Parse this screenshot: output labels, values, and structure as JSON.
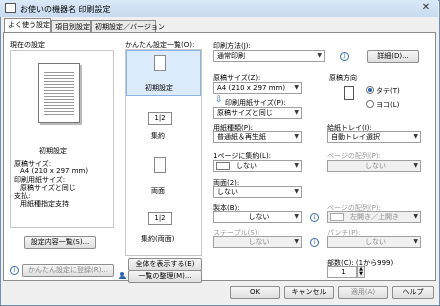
{
  "window": {
    "title": "お使いの機器名 印刷設定",
    "close": "✕"
  },
  "tabs": [
    "よく使う設定",
    "項目別設定",
    "初期設定／バージョン"
  ],
  "left": {
    "current_settings": "現在の設定",
    "preview_caption": "初期設定",
    "summary": [
      "原稿サイズ:",
      "A4 (210 x 297 mm)",
      "印刷用紙サイズ:",
      "原稿サイズと同じ",
      "支払:",
      "用紙種指定支持"
    ],
    "settings_list_button": "設定内容一覧(S)...",
    "register_button": "かんたん設定に登録(R)..."
  },
  "presets": {
    "header": "かんたん設定一覧(O):",
    "items": [
      {
        "label": "初期設定",
        "glyph": ""
      },
      {
        "label": "集約",
        "glyph": "1|2"
      },
      {
        "label": "両面",
        "glyph": ""
      },
      {
        "label": "集約(両面)",
        "glyph": "1|2"
      }
    ],
    "show_all_button": "全体を表示する(E)",
    "organize_button": "一覧の整理(M)..."
  },
  "right": {
    "print_method_label": "印刷方法(J):",
    "print_method_value": "通常印刷",
    "detail_button": "詳細(D)...",
    "original_size_label": "原稿サイズ(Z):",
    "original_size_value": "A4 (210 x 297 mm)",
    "paper_size_label": "印刷用紙サイズ(P):",
    "paper_size_value": "原稿サイズと同じ",
    "orientation_label": "原稿方向",
    "portrait": "タテ(T)",
    "landscape": "ヨコ(L)",
    "paper_type_label": "用紙種類(P):",
    "paper_type_value": "普通紙＆再生紙",
    "tray_label": "給紙トレイ(I):",
    "tray_value": "自動トレイ選択",
    "nup_label": "1ページに集約(L):",
    "nup_value": "しない",
    "nup_order_label": "ページの配列(P):",
    "nup_order_value": "しない",
    "duplex_label": "両面(2):",
    "duplex_value": "しない",
    "booklet_label": "製本(B):",
    "booklet_value": "しない",
    "booklet_order_label": "ページの配列(P):",
    "booklet_order_value": "左開き／上開き",
    "staple_label": "ステープル(S):",
    "staple_value": "しない",
    "punch_label": "パンチ(P):",
    "punch_value": "しない",
    "copies_label": "部数(C): (1から999)",
    "copies_value": "1"
  },
  "footer": {
    "ok": "OK",
    "cancel": "キャンセル",
    "apply": "適用(A)",
    "help": "ヘルプ"
  }
}
